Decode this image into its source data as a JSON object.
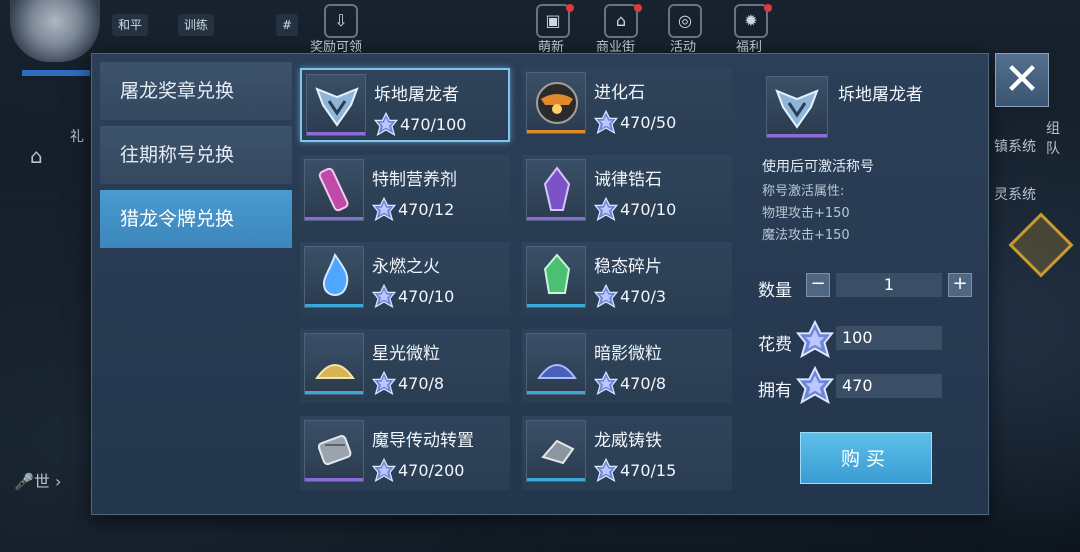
{
  "hud": {
    "chips": [
      "和平",
      "训练"
    ],
    "hash": "#",
    "icons": [
      {
        "label": "奖励可领",
        "icon": "download-icon"
      },
      {
        "label": "萌新",
        "icon": "bag-icon"
      },
      {
        "label": "商业街",
        "icon": "shop-icon"
      },
      {
        "label": "活动",
        "icon": "balloon-icon"
      },
      {
        "label": "福利",
        "icon": "gift-icon"
      }
    ],
    "side": [
      "礼",
      "镇系统",
      "灵系统",
      "组",
      "队",
      "世"
    ]
  },
  "tabs": [
    {
      "label": "屠龙奖章兑换",
      "active": false
    },
    {
      "label": "往期称号兑换",
      "active": false
    },
    {
      "label": "猎龙令牌兑换",
      "active": true
    }
  ],
  "items": [
    {
      "name": "坼地屠龙者",
      "price": "470/100",
      "icon": "dragon-emblem-icon",
      "rarity": "#8e6cd8",
      "selected": true
    },
    {
      "name": "进化石",
      "price": "470/50",
      "icon": "evolution-stone-icon",
      "rarity": "#e08a2c",
      "selected": false
    },
    {
      "name": "特制营养剂",
      "price": "470/12",
      "icon": "nutrient-vial-icon",
      "rarity": "#8e6cd8",
      "selected": false
    },
    {
      "name": "诫律锆石",
      "price": "470/10",
      "icon": "zircon-crystal-icon",
      "rarity": "#8e6cd8",
      "selected": false
    },
    {
      "name": "永燃之火",
      "price": "470/10",
      "icon": "eternal-flame-icon",
      "rarity": "#3aa9d8",
      "selected": false
    },
    {
      "name": "稳态碎片",
      "price": "470/3",
      "icon": "stable-shard-icon",
      "rarity": "#3aa9d8",
      "selected": false
    },
    {
      "name": "星光微粒",
      "price": "470/8",
      "icon": "star-dust-icon",
      "rarity": "#3aa9d8",
      "selected": false
    },
    {
      "name": "暗影微粒",
      "price": "470/8",
      "icon": "shadow-dust-icon",
      "rarity": "#3aa9d8",
      "selected": false
    },
    {
      "name": "魔导传动转置",
      "price": "470/200",
      "icon": "magic-gear-icon",
      "rarity": "#8e6cd8",
      "selected": false
    },
    {
      "name": "龙威铸铁",
      "price": "470/15",
      "icon": "dragon-iron-icon",
      "rarity": "#3aa9d8",
      "selected": false
    }
  ],
  "detail": {
    "name": "坼地屠龙者",
    "desc": "使用后可激活称号",
    "attr_title": "称号激活属性:",
    "attrs": [
      "物理攻击+150",
      "魔法攻击+150"
    ],
    "qty_label": "数量",
    "qty_minus": "−",
    "qty_plus": "+",
    "qty": "1",
    "cost_label": "花费",
    "cost": "100",
    "own_label": "拥有",
    "own": "470",
    "buy_label": "购买"
  },
  "close_label": "✕",
  "colors": {
    "accent": "#4a9bd0",
    "purple_rarity": "#8e6cd8",
    "blue_rarity": "#3aa9d8",
    "orange_rarity": "#e08a2c"
  }
}
